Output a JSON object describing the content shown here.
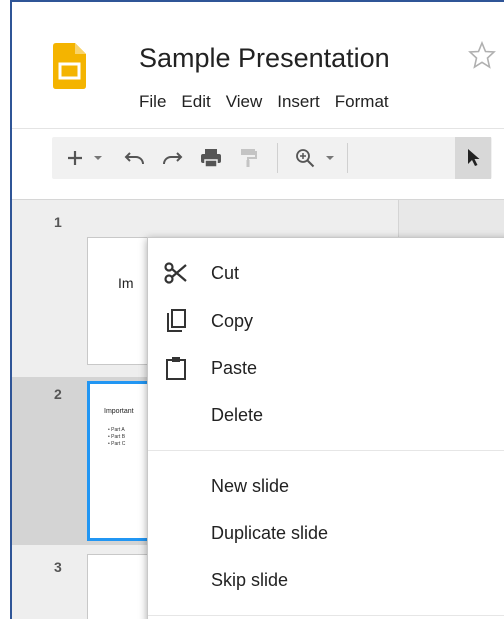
{
  "document": {
    "title": "Sample Presentation"
  },
  "menubar": [
    "File",
    "Edit",
    "View",
    "Insert",
    "Format"
  ],
  "toolbar": {
    "icons": [
      "add-icon",
      "dropdown-arrow-icon",
      "undo-icon",
      "redo-icon",
      "print-icon",
      "paint-format-icon",
      "zoom-icon",
      "dropdown-arrow-icon",
      "select-pointer-icon"
    ]
  },
  "slides": [
    {
      "number": "1",
      "title": "Im",
      "selected": false
    },
    {
      "number": "2",
      "title": "Important",
      "bullets": [
        "Part A",
        "Part B",
        "Part C"
      ],
      "selected": true
    },
    {
      "number": "3",
      "selected": false
    }
  ],
  "context_menu": {
    "items": [
      {
        "label": "Cut",
        "icon": "scissors-icon"
      },
      {
        "label": "Copy",
        "icon": "copy-icon"
      },
      {
        "label": "Paste",
        "icon": "paste-icon"
      },
      {
        "label": "Delete",
        "icon": ""
      },
      {
        "label": "New slide",
        "icon": ""
      },
      {
        "label": "Duplicate slide",
        "icon": ""
      },
      {
        "label": "Skip slide",
        "icon": ""
      }
    ]
  },
  "colors": {
    "selection_blue": "#2196f3",
    "logo_yellow": "#f4b400",
    "frame_border": "#2f5597"
  }
}
